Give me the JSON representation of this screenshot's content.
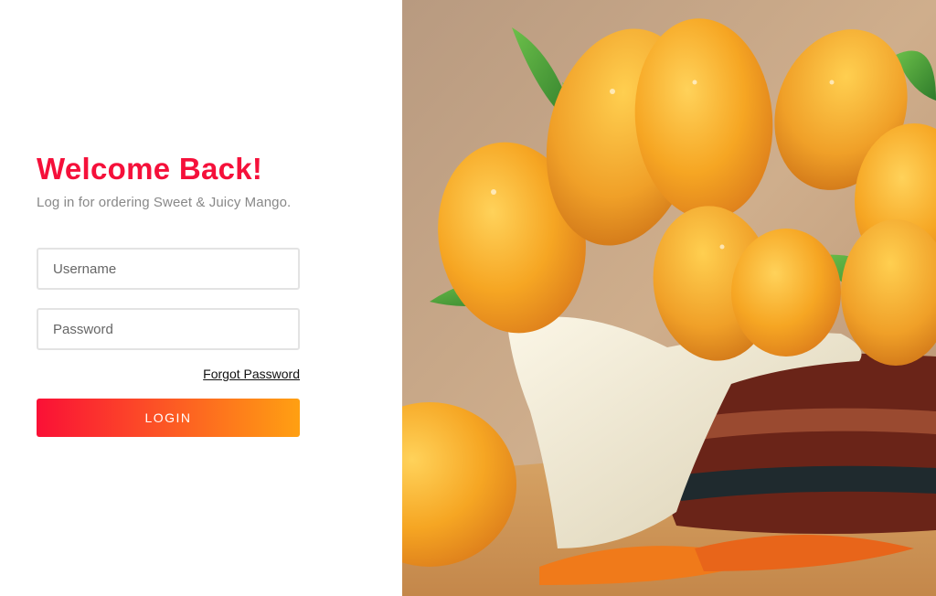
{
  "login": {
    "title": "Welcome Back!",
    "subtitle": "Log in for ordering Sweet & Juicy Mango.",
    "username_placeholder": "Username",
    "password_placeholder": "Password",
    "forgot_label": "Forgot Password",
    "button_label": "LOGIN"
  },
  "colors": {
    "accent": "#f5103a",
    "gradient_start": "#fa1036",
    "gradient_end": "#ffa012",
    "subtitle_text": "#888888",
    "mango": "#f5a623",
    "leaf": "#3f9a3a",
    "cloth": "#f2ecd8",
    "basket": "#7a2f20",
    "wall": "#c8a27e"
  },
  "hero": {
    "icon": "mango-basket-photo"
  }
}
